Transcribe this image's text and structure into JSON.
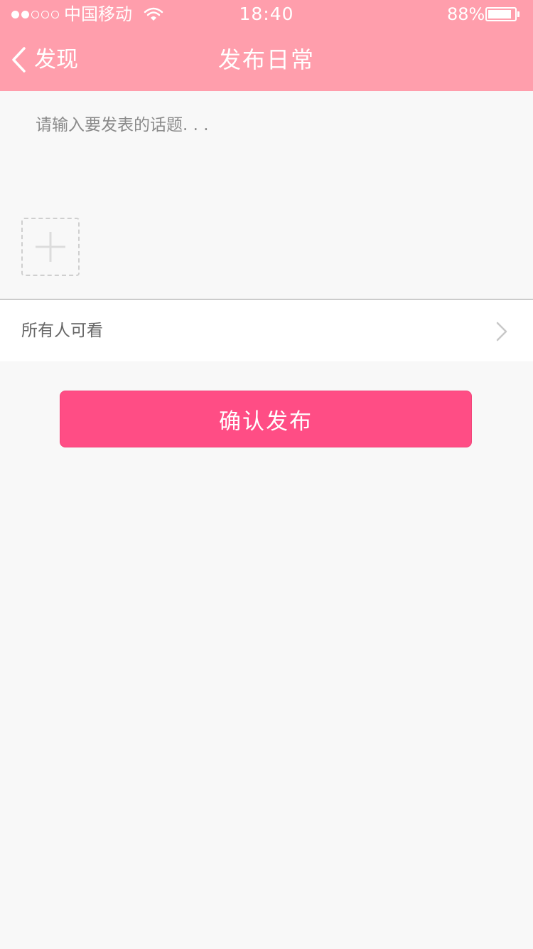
{
  "status_bar": {
    "signal_bars_filled": 2,
    "signal_bars_total": 5,
    "carrier": "中国移动",
    "time": "18:40",
    "battery_percent_label": "88%",
    "battery_level": 0.88
  },
  "nav": {
    "back_label": "发现",
    "title": "发布日常"
  },
  "compose": {
    "placeholder": "请输入要发表的话题. . .",
    "value": "",
    "add_image_icon": "plus-icon"
  },
  "visibility": {
    "label": "所有人可看",
    "icon": "chevron-right-icon"
  },
  "confirm_button": {
    "label": "确认发布"
  },
  "colors": {
    "header_bg": "#ff9eac",
    "button_bg": "#ff4d85",
    "page_bg": "#f8f8f8"
  }
}
